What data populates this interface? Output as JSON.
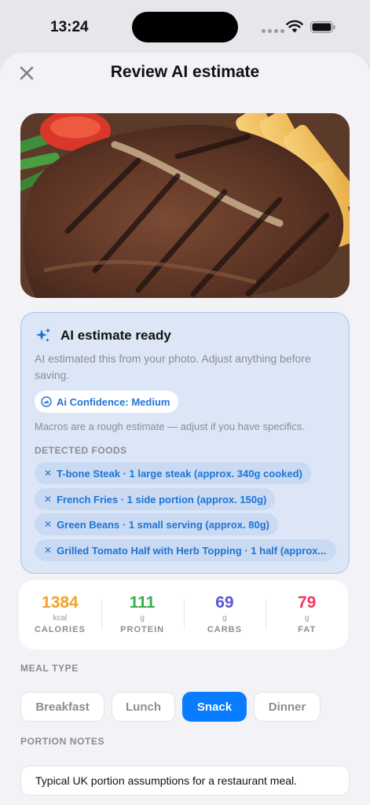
{
  "status_bar": {
    "time": "13:24"
  },
  "header": {
    "title": "Review AI estimate"
  },
  "photo": {
    "subject": "T-bone steak with french fries, green beans and grilled tomato"
  },
  "ai_card": {
    "title": "AI estimate ready",
    "description": "AI estimated this from your photo. Adjust anything before saving.",
    "confidence": "Ai Confidence: Medium",
    "macro_note": "Macros are a rough estimate — adjust if you have specifics.",
    "detected_label": "DETECTED FOODS",
    "foods": [
      "T-bone Steak · 1 large steak (approx. 340g cooked)",
      "French Fries · 1 side portion (approx. 150g)",
      "Green Beans · 1 small serving (approx. 80g)",
      "Grilled Tomato Half with Herb Topping · 1 half (approx..."
    ]
  },
  "macros": [
    {
      "value": "1384",
      "unit": "kcal",
      "label": "CALORIES",
      "color": "#f4a12a"
    },
    {
      "value": "111",
      "unit": "g",
      "label": "PROTEIN",
      "color": "#34b04c"
    },
    {
      "value": "69",
      "unit": "g",
      "label": "CARBS",
      "color": "#5856d6"
    },
    {
      "value": "79",
      "unit": "g",
      "label": "FAT",
      "color": "#ef3a60"
    }
  ],
  "meal_type": {
    "label": "MEAL TYPE",
    "options": [
      "Breakfast",
      "Lunch",
      "Snack",
      "Dinner"
    ],
    "selected": "Snack"
  },
  "portion_notes": {
    "label": "PORTION NOTES",
    "value": "Typical UK portion assumptions for a restaurant meal."
  },
  "colors": {
    "accent": "#0a7cff",
    "chip_text": "#1f74d6",
    "card_bg": "#dde6f6"
  }
}
